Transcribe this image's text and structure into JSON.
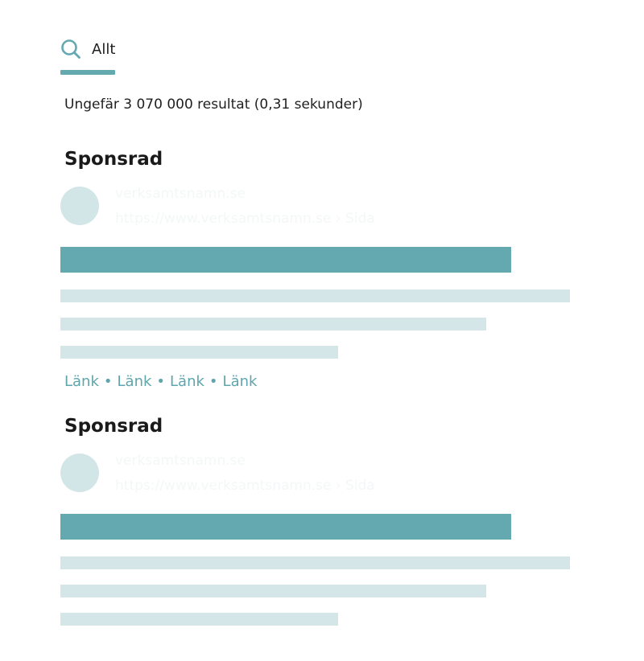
{
  "tabs": [
    {
      "label": "Allt",
      "icon": "search-icon",
      "active": true
    }
  ],
  "result_stats": "Ungefär 3 070 000 resultat (0,31 sekunder)",
  "ads": [
    {
      "sponsored_label": "Sponsrad",
      "site_name": "verksamtsnamn.se",
      "site_url": "https://www.verksamtsnamn.se › Sida",
      "sitelinks": [
        "Länk",
        "Länk",
        "Länk",
        "Länk"
      ],
      "sitelink_separator": "•"
    },
    {
      "sponsored_label": "Sponsrad",
      "site_name": "verksamtsnamn.se",
      "site_url": "https://www.verksamtsnamn.se › Sida"
    }
  ],
  "colors": {
    "accent": "#64a9b0",
    "placeholder": "#d4e6e7",
    "link": "#5fa5ac",
    "text": "#1a1a1a"
  }
}
